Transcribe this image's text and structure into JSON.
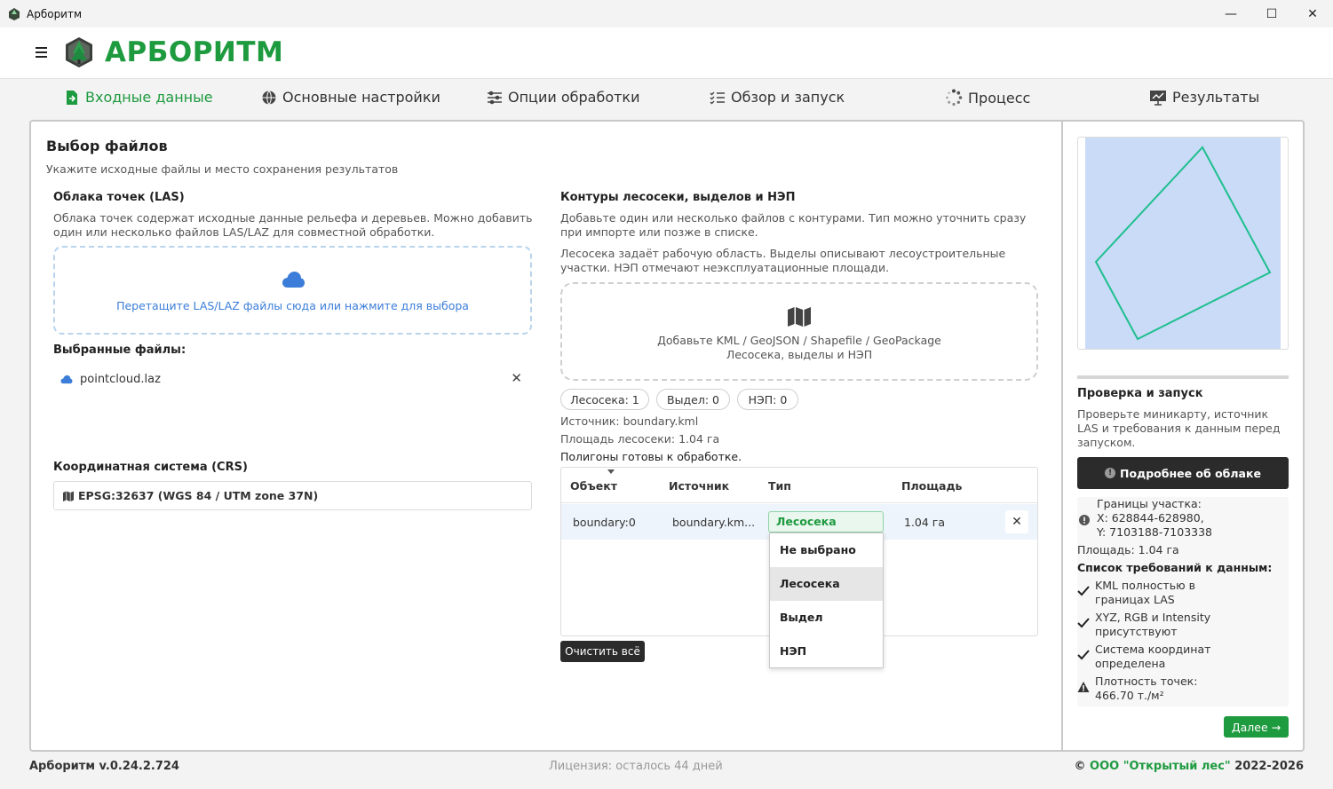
{
  "window": {
    "title": "Арборитм",
    "minimize": "—",
    "maximize": "☐",
    "close": "✕"
  },
  "header": {
    "logo_text": "АРБОРИТМ"
  },
  "tabs": [
    {
      "label": "Входные данные",
      "icon": "file-arrow-icon",
      "active": true
    },
    {
      "label": "Основные настройки",
      "icon": "globe-icon",
      "active": false
    },
    {
      "label": "Опции обработки",
      "icon": "sliders-icon",
      "active": false
    },
    {
      "label": "Обзор и запуск",
      "icon": "checklist-icon",
      "active": false
    },
    {
      "label": "Процесс",
      "icon": "spinner-icon",
      "active": false
    },
    {
      "label": "Результаты",
      "icon": "chart-board-icon",
      "active": false
    }
  ],
  "page": {
    "title": "Выбор файлов",
    "subtitle": "Укажите исходные файлы и место сохранения результатов"
  },
  "las": {
    "title": "Облака точек (LAS)",
    "desc1": "Облака точек содержат исходные данные рельефа и деревьев. Можно добавить",
    "desc2": "один или несколько файлов LAS/LAZ для совместной обработки.",
    "drop_label": "Перетащите LAS/LAZ файлы сюда или нажмите для выбора",
    "selected_title": "Выбранные файлы:",
    "files": [
      {
        "name": "pointcloud.laz",
        "remove": "✕"
      }
    ]
  },
  "crs": {
    "title": "Координатная система (CRS)",
    "value": "EPSG:32637 (WGS 84 / UTM zone 37N)"
  },
  "contours": {
    "title": "Контуры лесосеки, выделов и НЭП",
    "desc1": "Добавьте один или несколько файлов с контурами. Тип можно уточнить сразу",
    "desc2": "при импорте или позже в списке.",
    "desc3": "Лесосека задаёт рабочую область. Выделы описывают лесоустроительные",
    "desc4": "участки. НЭП отмечают неэксплуатационные площади.",
    "drop_line1": "Добавьте KML / GeoJSON / Shapefile / GeoPackage",
    "drop_line2": "Лесосека, выделы и НЭП",
    "pills": [
      "Лесосека: 1",
      "Выдел: 0",
      "НЭП: 0"
    ],
    "source": "Источник: boundary.kml",
    "area": "Площадь лесосеки: 1.04 га",
    "ready": "Полигоны готовы к обработке.",
    "table": {
      "headers": [
        "Объект",
        "Источник",
        "Тип",
        "Площадь"
      ],
      "rows": [
        {
          "object": "boundary:0",
          "source": "boundary.km...",
          "type": "Лесосека",
          "area": "1.04 га",
          "remove": "✕"
        }
      ]
    },
    "dropdown": [
      "Не выбрано",
      "Лесосека",
      "Выдел",
      "НЭП"
    ],
    "clear_button": "Очистить всё"
  },
  "right": {
    "check_title": "Проверка и запуск",
    "check_text": "Проверьте миникарту, источник LAS и требования к данным перед запуском.",
    "cloud_button": "Подробнее об облаке",
    "bounds_title": "Границы участка:",
    "bounds_x": "X: 628844-628980,",
    "bounds_y": "Y: 7103188-7103338",
    "area": "Площадь: 1.04 га",
    "req_title": "Список требований к данным:",
    "req": [
      {
        "l1": "KML полностью в",
        "l2": "границах LAS",
        "status": "ok"
      },
      {
        "l1": "XYZ, RGB и Intensity",
        "l2": "присутствуют",
        "status": "ok"
      },
      {
        "l1": "Система координат",
        "l2": "определена",
        "status": "ok"
      },
      {
        "l1": "Плотность точек:",
        "l2": "466.70 т./м²",
        "status": "warn"
      }
    ],
    "next_button": "Далее →"
  },
  "footer": {
    "version": "Арборитм v.0.24.2.724",
    "license": "Лицензия: осталось 44 дней",
    "copy_prefix": "©",
    "org": "ООО \"Открытый лес\"",
    "years": "2022-2026"
  },
  "colors": {
    "brand_green": "#1e9a3f",
    "link_blue": "#3b7dd8",
    "map_fill": "#c9dbf7",
    "polygon": "#1fbf8f"
  }
}
